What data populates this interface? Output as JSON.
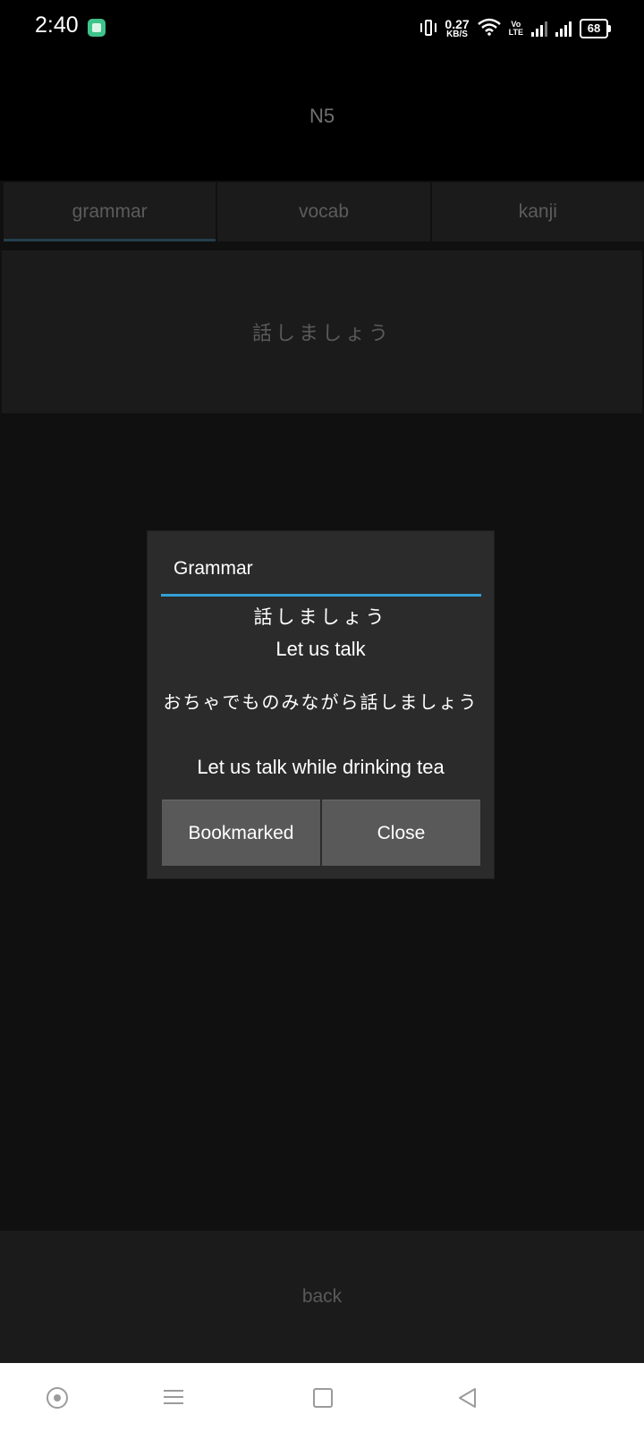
{
  "status_bar": {
    "time": "2:40",
    "net_speed_value": "0.27",
    "net_speed_unit": "KB/S",
    "volte_top": "Vo",
    "volte_bottom": "LTE",
    "battery": "68",
    "app_icon": "notification-app-icon",
    "vibrate_icon": "vibrate-icon",
    "wifi_icon": "wifi-icon",
    "signal_icons": [
      "signal-1-icon",
      "signal-2-icon"
    ]
  },
  "header": {
    "title": "N5"
  },
  "tabs": [
    {
      "label": "grammar",
      "active": true
    },
    {
      "label": "vocab",
      "active": false
    },
    {
      "label": "kanji",
      "active": false
    }
  ],
  "grammar_item": {
    "text": "話しましょう"
  },
  "dialog": {
    "title": "Grammar",
    "jp_title": "話しましょう",
    "en_title": "Let us talk",
    "jp_example": "おちゃでものみながら話しましょう",
    "en_example": "Let us talk while drinking tea",
    "buttons": {
      "bookmarked": "Bookmarked",
      "close": "Close"
    },
    "accent_color": "#33a1d6"
  },
  "back_button": {
    "label": "back"
  },
  "nav_bar": {
    "icons": [
      "assistant-circle-icon",
      "menu-icon",
      "home-square-icon",
      "back-triangle-icon"
    ]
  }
}
